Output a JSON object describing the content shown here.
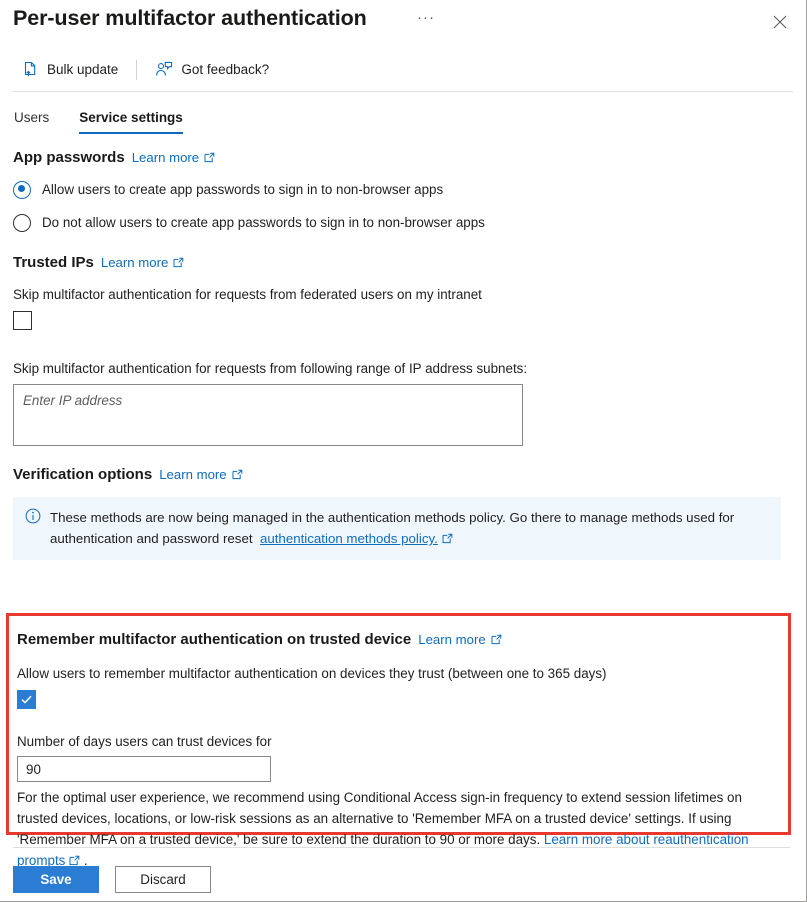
{
  "header": {
    "title": "Per-user multifactor authentication",
    "ellipsis": "···",
    "close_label": "Close"
  },
  "commandbar": {
    "items": [
      {
        "label": "Bulk update",
        "icon": "document-upload-icon"
      },
      {
        "label": "Got feedback?",
        "icon": "person-feedback-icon"
      }
    ]
  },
  "tabs": [
    {
      "label": "Users",
      "active": false
    },
    {
      "label": "Service settings",
      "active": true
    }
  ],
  "app_passwords": {
    "title": "App passwords",
    "learn_more": "Learn more",
    "options": [
      {
        "label": "Allow users to create app passwords to sign in to non-browser apps",
        "selected": true
      },
      {
        "label": "Do not allow users to create app passwords to sign in to non-browser apps",
        "selected": false
      }
    ]
  },
  "trusted_ips": {
    "title": "Trusted IPs",
    "learn_more": "Learn more",
    "federated_label": "Skip multifactor authentication for requests from federated users on my intranet",
    "federated_checked": false,
    "subnets_label": "Skip multifactor authentication for requests from following range of IP address subnets:",
    "ip_value": "",
    "ip_placeholder": "Enter IP address"
  },
  "verification_options": {
    "title": "Verification options",
    "learn_more": "Learn more",
    "banner": {
      "icon": "info-icon",
      "text": "These methods are now being managed in the authentication methods policy. Go there to manage methods used for authentication and password reset",
      "link": "authentication methods policy."
    }
  },
  "remember_mfa": {
    "title": "Remember multifactor authentication on trusted device",
    "learn_more": "Learn more",
    "allow_label": "Allow users to remember multifactor authentication on devices they trust (between one to 365 days)",
    "allow_checked": true,
    "days_label": "Number of days users can trust devices for",
    "days_value": "90",
    "recommendation_text": "For the optimal user experience, we recommend using Conditional Access sign-in frequency to extend session lifetimes on trusted devices, locations, or low-risk sessions as an alternative to 'Remember MFA on a trusted device' settings. If using 'Remember MFA on a trusted device,' be sure to extend the duration to 90 or more days.",
    "recommendation_link": "Learn more about reauthentication prompts",
    "recommendation_tail": "."
  },
  "footer": {
    "save_label": "Save",
    "discard_label": "Discard"
  },
  "colors": {
    "accent": "#0f6cbd",
    "control_blue": "#2b7cd3",
    "highlight_red": "#e8392e",
    "banner_bg": "#eff6fc"
  }
}
